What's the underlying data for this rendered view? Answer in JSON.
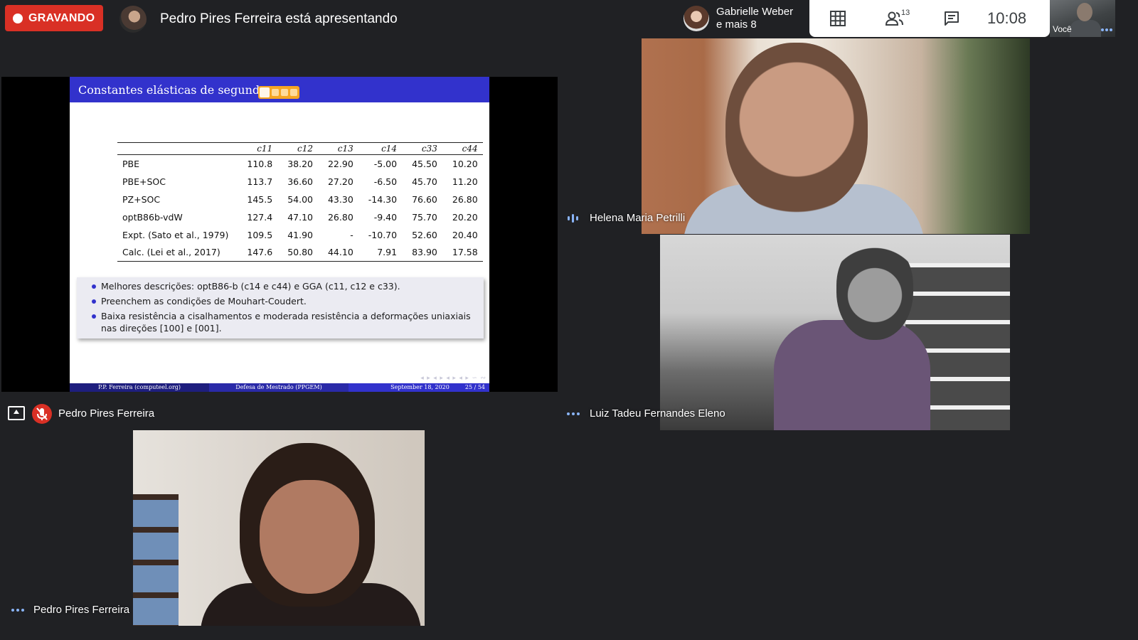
{
  "recording": {
    "label": "GRAVANDO"
  },
  "presenting": {
    "text": "Pedro Pires Ferreira está apresentando"
  },
  "participants_pill": {
    "line1": "Gabrielle Weber",
    "line2": "e mais 8"
  },
  "toolbar": {
    "participant_count": "13",
    "clock": "10:08"
  },
  "self_view": {
    "label": "Você"
  },
  "slide": {
    "title": "Constantes elásticas de segunda o",
    "table_header": [
      "c11",
      "c12",
      "c13",
      "c14",
      "c33",
      "c44"
    ],
    "rows": [
      {
        "name": "PBE",
        "values": [
          "110.8",
          "38.20",
          "22.90",
          "-5.00",
          "45.50",
          "10.20"
        ]
      },
      {
        "name": "PBE+SOC",
        "values": [
          "113.7",
          "36.60",
          "27.20",
          "-6.50",
          "45.70",
          "11.20"
        ]
      },
      {
        "name": "PZ+SOC",
        "values": [
          "145.5",
          "54.00",
          "43.30",
          "-14.30",
          "76.60",
          "26.80"
        ]
      },
      {
        "name": "optB86b-vdW",
        "values": [
          "127.4",
          "47.10",
          "26.80",
          "-9.40",
          "75.70",
          "20.20"
        ]
      },
      {
        "name": "Expt. (Sato et al., 1979)",
        "values": [
          "109.5",
          "41.90",
          "-",
          "-10.70",
          "52.60",
          "20.40"
        ]
      },
      {
        "name": "Calc. (Lei et al., 2017)",
        "values": [
          "147.6",
          "50.80",
          "44.10",
          "7.91",
          "83.90",
          "17.58"
        ]
      }
    ],
    "bullets": [
      "Melhores descrições: optB86-b (c14 e c44) e GGA (c11, c12 e c33).",
      "Preenchem as condições de Mouhart-Coudert.",
      "Baixa resistência a cisalhamentos e moderada resistência a deformações uniaxiais nas direções [100] e [001]."
    ],
    "footer": {
      "author": "P.P. Ferreira (computeel.org)",
      "event": "Defesa de Mestrado (PPGEM)",
      "date": "September 18, 2020",
      "page": "25 / 54"
    }
  },
  "presentation_tile": {
    "name": "Pedro Pires Ferreira"
  },
  "tiles": {
    "helena": {
      "name": "Helena Maria Petrilli"
    },
    "luiz": {
      "name": "Luiz Tadeu Fernandes Eleno"
    },
    "pedro": {
      "name": "Pedro Pires Ferreira"
    }
  },
  "colors": {
    "recording": "#d93025",
    "slide_blue": "#3232cc",
    "activity": "#8ab4f8"
  }
}
